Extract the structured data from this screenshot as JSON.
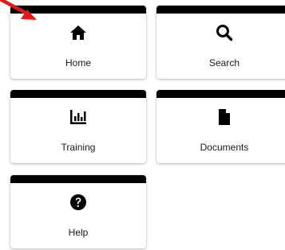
{
  "tiles": [
    {
      "id": "home",
      "label": "Home",
      "icon": "home-icon"
    },
    {
      "id": "search",
      "label": "Search",
      "icon": "search-icon"
    },
    {
      "id": "training",
      "label": "Training",
      "icon": "bar-chart-icon"
    },
    {
      "id": "documents",
      "label": "Documents",
      "icon": "document-icon"
    },
    {
      "id": "help",
      "label": "Help",
      "icon": "help-circle-icon"
    }
  ],
  "colors": {
    "tile_bar": "#000000",
    "icon": "#000000",
    "pointer_arrow": "#e01a1a"
  }
}
